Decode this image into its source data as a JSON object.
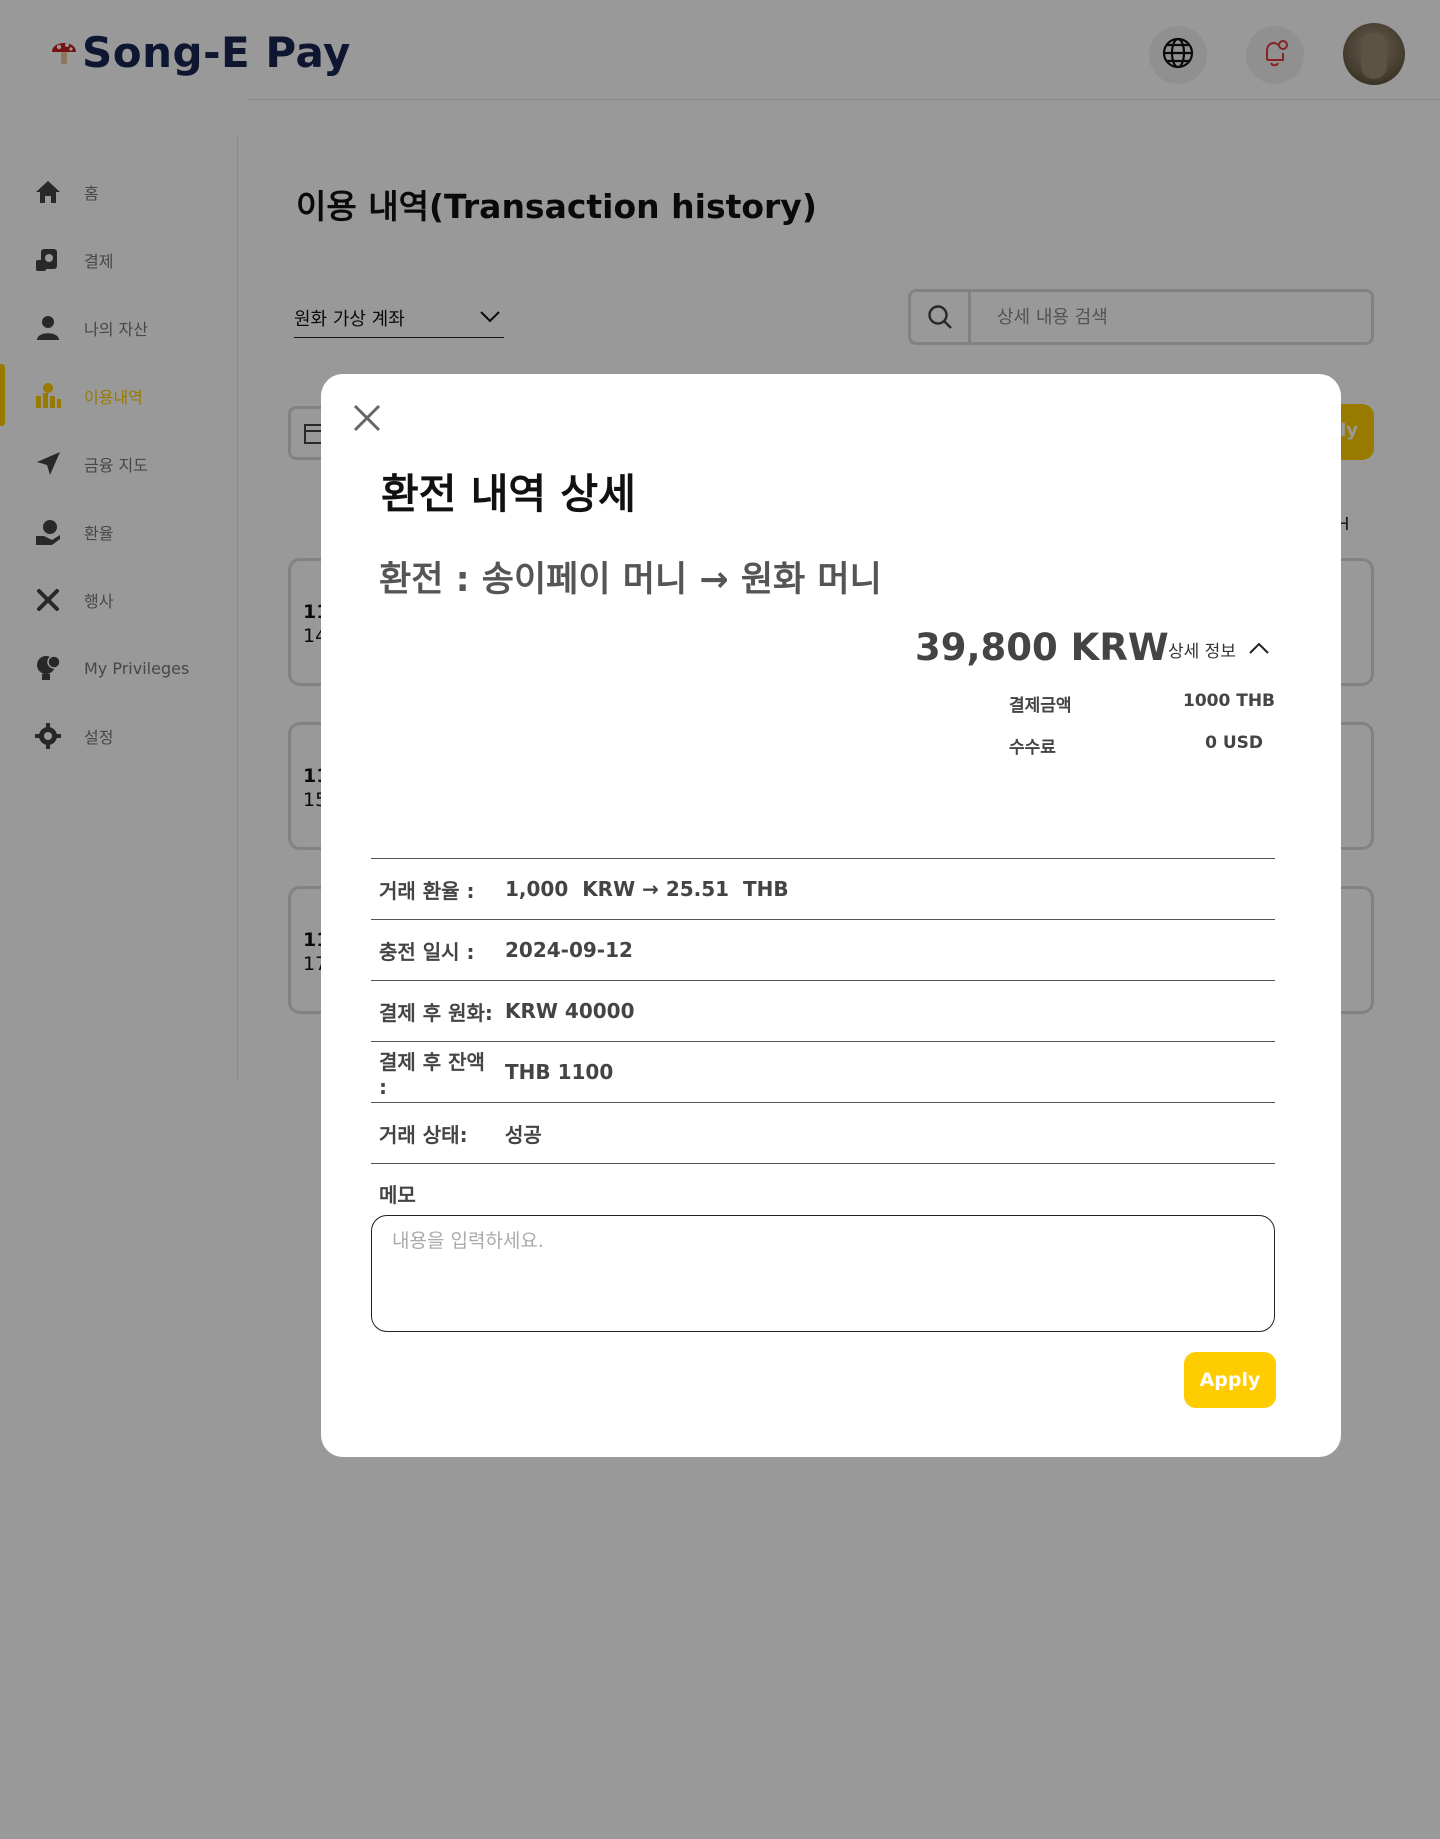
{
  "header": {
    "brand": "Song-E Pay",
    "language_icon": "globe-icon",
    "notification_icon": "bell-icon",
    "profile_icon": "avatar"
  },
  "sidebar": {
    "items": [
      {
        "label": "홈",
        "icon": "home-icon"
      },
      {
        "label": "결제",
        "icon": "payment-icon"
      },
      {
        "label": "나의 자산",
        "icon": "user-icon"
      },
      {
        "label": "이용내역",
        "icon": "history-icon",
        "active": true
      },
      {
        "label": "금융 지도",
        "icon": "navigation-icon"
      },
      {
        "label": "환율",
        "icon": "exchange-icon"
      },
      {
        "label": "행사",
        "icon": "tools-icon"
      },
      {
        "label": "My Privileges",
        "icon": "privileges-icon"
      },
      {
        "label": "설정",
        "icon": "gear-icon"
      }
    ]
  },
  "main": {
    "title": "이용 내역(Transaction history)",
    "account_select": "원화 가상 계좌",
    "search_placeholder": "상세 내용 검색",
    "apply_partial": "ly",
    "more_partial": "H",
    "cards": [
      {
        "line1": "11",
        "line2": "14"
      },
      {
        "line1": "11",
        "line2": "15"
      },
      {
        "line1": "11",
        "line2": "17"
      }
    ]
  },
  "modal": {
    "title": "환전 내역 상세",
    "subtitle": "환전 : 송이페이 머니 → 원화 머니",
    "amount": "39,800 KRW",
    "detail_toggle": "상세 정보",
    "breakdown": [
      {
        "label": "결제금액",
        "value": "1000 THB"
      },
      {
        "label": "수수료",
        "value": "0 USD"
      }
    ],
    "info": [
      {
        "label": "거래 환율 :",
        "value": "1,000  KRW → 25.51  THB"
      },
      {
        "label": "충전 일시 :",
        "value": "2024-09-12"
      },
      {
        "label": "결제 후 원화:",
        "value": "KRW 40000"
      },
      {
        "label": "결제 후 잔액 :",
        "value": "THB 1100"
      },
      {
        "label": "거래 상태:",
        "value": "성공"
      }
    ],
    "memo_label": "메모",
    "memo_placeholder": "내용을 입력하세요.",
    "apply": "Apply"
  },
  "colors": {
    "accent": "#ffcc00",
    "brand": "#1a2552",
    "overlay": "rgba(0,0,0,0.40)"
  }
}
